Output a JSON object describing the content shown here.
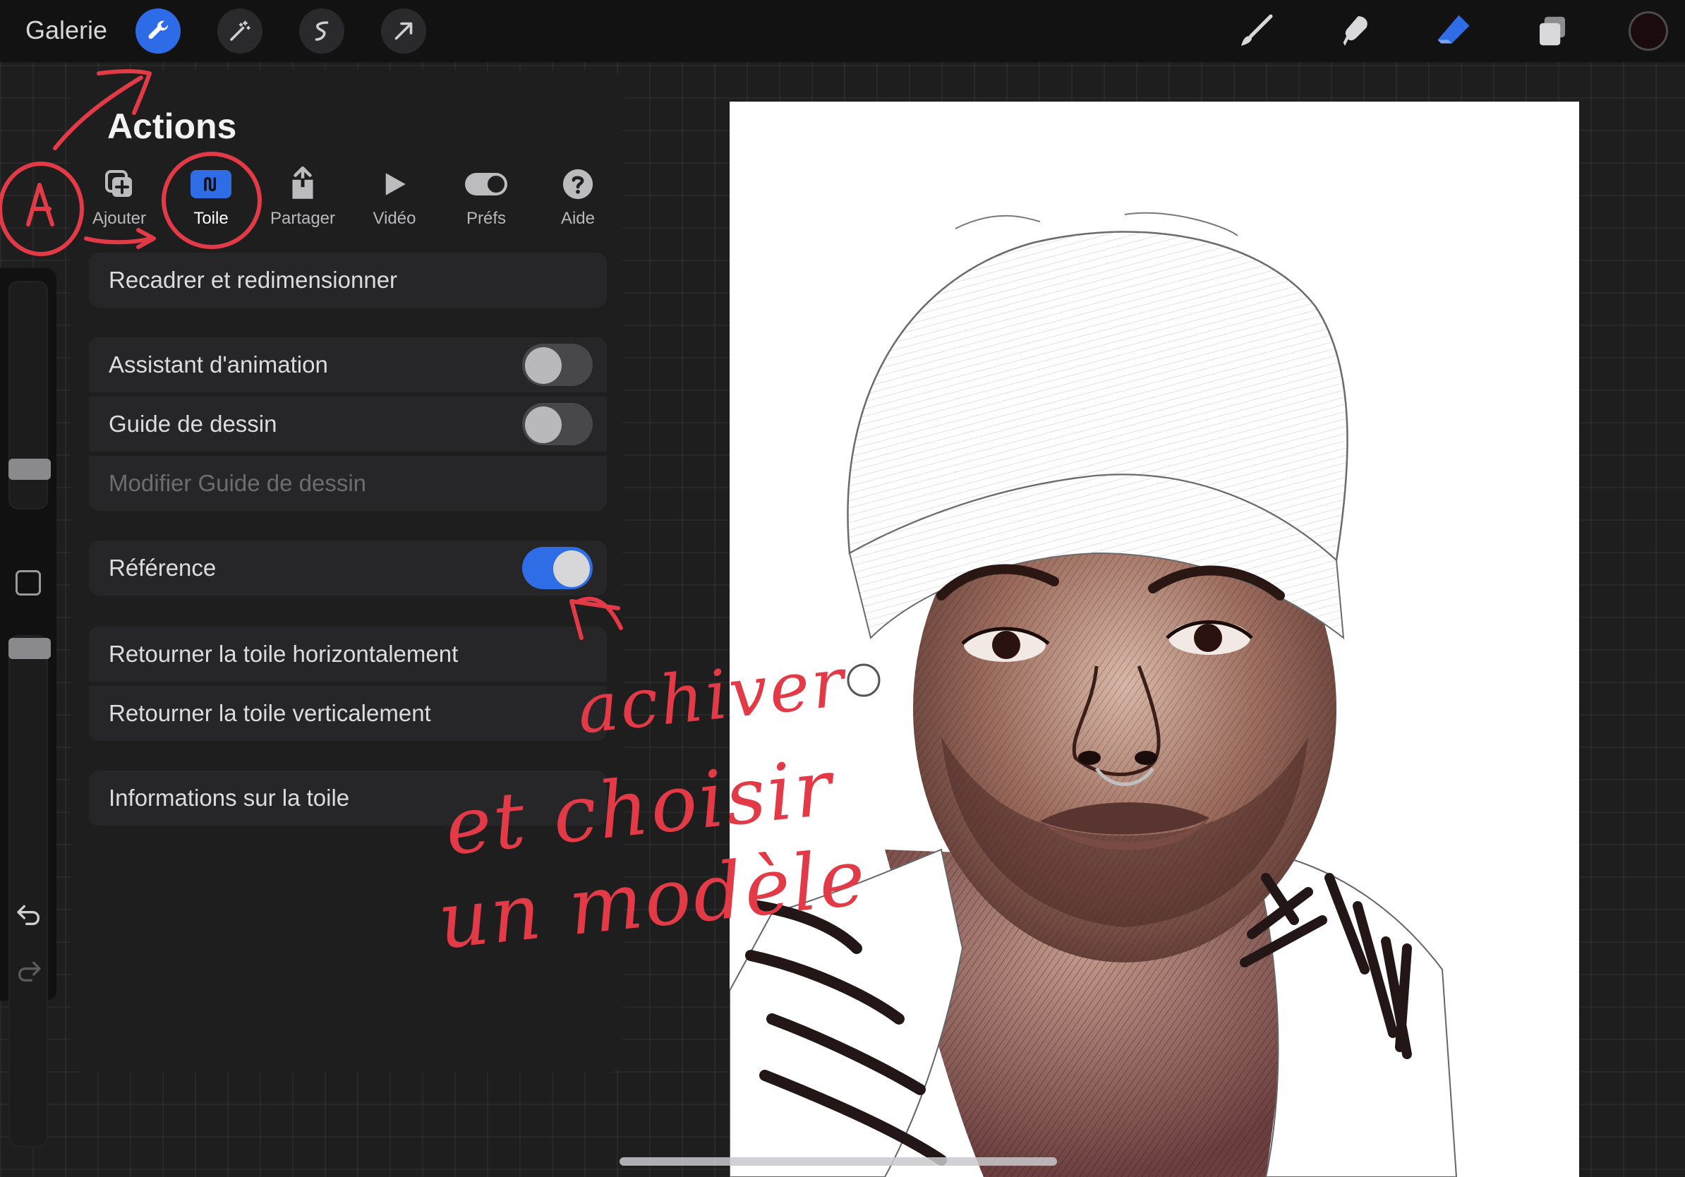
{
  "toolbar": {
    "gallery_label": "Galerie",
    "left_tools": [
      {
        "icon": "wrench-icon",
        "name": "actions",
        "active": true
      },
      {
        "icon": "magic-wand-icon",
        "name": "adjustments",
        "active": false
      },
      {
        "icon": "selection-icon",
        "name": "selection",
        "active": false
      },
      {
        "icon": "transform-arrow-icon",
        "name": "transform",
        "active": false
      }
    ],
    "right_tools": [
      {
        "icon": "brush-icon",
        "name": "paint"
      },
      {
        "icon": "smudge-icon",
        "name": "smudge"
      },
      {
        "icon": "eraser-icon",
        "name": "erase",
        "active": true
      },
      {
        "icon": "layers-icon",
        "name": "layers"
      }
    ],
    "current_color": "#1c0b0d"
  },
  "panel": {
    "title": "Actions",
    "tabs": [
      {
        "label": "Ajouter",
        "icon": "add-image-icon"
      },
      {
        "label": "Toile",
        "icon": "canvas-wave-icon",
        "active": true
      },
      {
        "label": "Partager",
        "icon": "share-icon"
      },
      {
        "label": "Vidéo",
        "icon": "play-icon"
      },
      {
        "label": "Préfs",
        "icon": "toggle-icon"
      },
      {
        "label": "Aide",
        "icon": "help-icon"
      }
    ],
    "items": {
      "crop": "Recadrer et redimensionner",
      "animation": "Assistant d'animation",
      "drawing_guide": "Guide de dessin",
      "edit_guide": "Modifier Guide de dessin",
      "reference": "Référence",
      "flip_h": "Retourner la toile horizontalement",
      "flip_v": "Retourner la toile verticalement",
      "info": "Informations sur la toile"
    },
    "toggles": {
      "animation": false,
      "drawing_guide": false,
      "reference": true
    }
  },
  "annotations": {
    "line1": "achiver",
    "line2": "et choisir",
    "line3": "un modèle",
    "color": "#e23a46"
  },
  "accent": "#2f6de6"
}
